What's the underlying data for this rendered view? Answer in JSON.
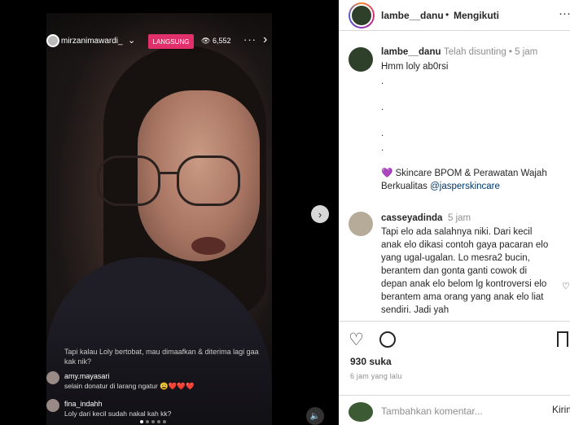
{
  "live": {
    "username": "mirzanimawardi_",
    "badge": "LANGSUNG",
    "viewers": "6,552",
    "overlay_comment": "Tapi kalau Loly bertobat, mau dimaafkan & diterima lagi gaa kak nik?",
    "comments": [
      {
        "user": "amy.mayasari",
        "text": "selain donatur di larang ngatur 😩❤️❤️❤️"
      },
      {
        "user": "fina_indahh",
        "text": "Loly dari kecil sudah nakal kah kk?"
      }
    ]
  },
  "post": {
    "header": {
      "username": "lambe__danu",
      "separator": "•",
      "follow_label": "Mengikuti",
      "more_label": "···"
    },
    "caption": {
      "username": "lambe__danu",
      "meta": "Telah disunting • 5 jam",
      "line1": "Hmm loly ab0rsi",
      "dots": [
        ".",
        ".",
        ".",
        "."
      ],
      "promo_prefix": "💜 Skincare BPOM & Perawatan Wajah Berkualitas ",
      "promo_link": "@jasperskincare"
    },
    "comment": {
      "username": "casseyadinda",
      "meta": "5 jam",
      "text": "Tapi elo ada salahnya niki. Dari kecil anak elo dikasi contoh gaya pacaran elo yang ugal-ugalan. Lo mesra2 bucin, berantem dan gonta ganti cowok di depan anak elo belom lg kontroversi elo berantem ama orang yang anak elo liat sendiri. Jadi yah"
    },
    "likes": "930 suka",
    "time_ago": "6 jam yang lalu",
    "add_comment_placeholder": "Tambahkan komentar...",
    "post_label": "Kirim"
  }
}
